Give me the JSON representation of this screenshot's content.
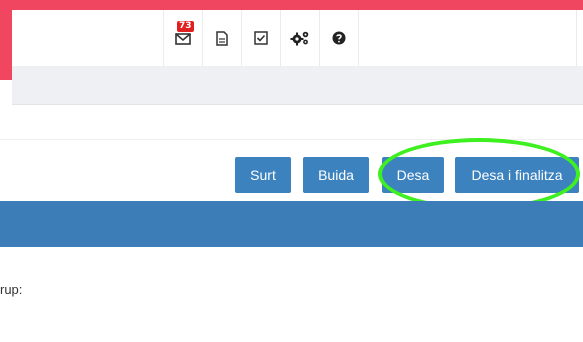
{
  "toolbar": {
    "mail_badge": "73",
    "icons": [
      "mail-icon",
      "document-icon",
      "checkbox-icon",
      "gears-icon",
      "help-icon"
    ]
  },
  "actions": {
    "surt": "Surt",
    "buida": "Buida",
    "desa": "Desa",
    "desa_finalitza": "Desa i finalitza"
  },
  "form": {
    "group_label": "rup:"
  },
  "colors": {
    "frame": "#f0465f",
    "primary": "#3c82bf",
    "section": "#3c7db8",
    "highlight": "#3ff020"
  }
}
